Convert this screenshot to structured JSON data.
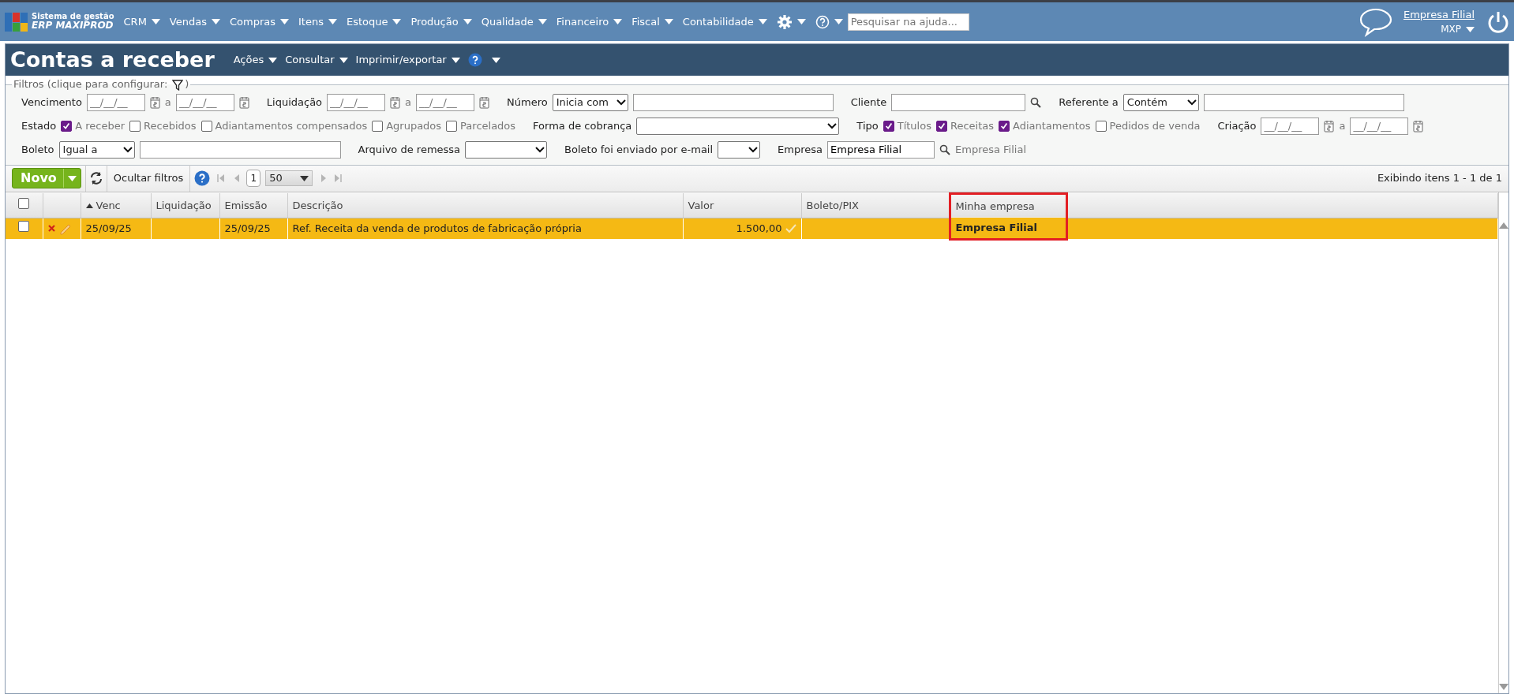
{
  "topbar": {
    "logo_line1": "Sistema de gestão",
    "logo_line2": "ERP MAXIPROD",
    "menu": [
      "CRM",
      "Vendas",
      "Compras",
      "Itens",
      "Estoque",
      "Produção",
      "Qualidade",
      "Financeiro",
      "Fiscal",
      "Contabilidade"
    ],
    "search": {
      "placeholder": "Pesquisar na ajuda..."
    },
    "company_link": "Empresa Filial",
    "user": "MXP"
  },
  "page": {
    "title": "Contas a receber",
    "menu": [
      "Ações",
      "Consultar",
      "Imprimir/exportar"
    ]
  },
  "filters": {
    "legend_start": "Filtros (clique para configurar:",
    "legend_end": ")",
    "rows": [
      {
        "items": [
          {
            "kind": "label",
            "text": "Vencimento"
          },
          {
            "kind": "date",
            "placeholder": "__/__/__"
          },
          {
            "kind": "sep",
            "text": "a"
          },
          {
            "kind": "date",
            "placeholder": "__/__/__"
          },
          {
            "kind": "label",
            "text": "Liquidação"
          },
          {
            "kind": "date",
            "placeholder": "__/__/__"
          },
          {
            "kind": "sep",
            "text": "a"
          },
          {
            "kind": "date",
            "placeholder": "__/__/__"
          },
          {
            "kind": "label",
            "text": "Número"
          },
          {
            "kind": "select",
            "value": "Inicia com"
          },
          {
            "kind": "input"
          },
          {
            "kind": "label",
            "text": "Cliente"
          },
          {
            "kind": "input"
          },
          {
            "kind": "search"
          },
          {
            "kind": "label",
            "text": "Referente a"
          },
          {
            "kind": "select",
            "value": "Contém"
          },
          {
            "kind": "input"
          }
        ]
      },
      {
        "items": [
          {
            "kind": "label",
            "text": "Estado"
          },
          {
            "kind": "checkbox",
            "text": "A receber",
            "checked": true
          },
          {
            "kind": "checkbox",
            "text": "Recebidos",
            "checked": false
          },
          {
            "kind": "checkbox",
            "text": "Adiantamentos compensados",
            "checked": false
          },
          {
            "kind": "checkbox",
            "text": "Agrupados",
            "checked": false
          },
          {
            "kind": "checkbox",
            "text": "Parcelados",
            "checked": false
          },
          {
            "kind": "label",
            "text": "Forma de cobrança"
          },
          {
            "kind": "select"
          },
          {
            "kind": "label",
            "text": "Tipo"
          },
          {
            "kind": "checkbox",
            "text": "Títulos",
            "checked": true
          },
          {
            "kind": "checkbox",
            "text": "Receitas",
            "checked": true
          },
          {
            "kind": "checkbox",
            "text": "Adiantamentos",
            "checked": true
          },
          {
            "kind": "checkbox",
            "text": "Pedidos de venda",
            "checked": false
          },
          {
            "kind": "label",
            "text": "Criação"
          },
          {
            "kind": "date",
            "placeholder": "__/__/__"
          },
          {
            "kind": "sep",
            "text": "a"
          },
          {
            "kind": "date",
            "placeholder": "__/__/__"
          }
        ]
      },
      {
        "items": [
          {
            "kind": "label",
            "text": "Boleto"
          },
          {
            "kind": "select",
            "value": "Igual a"
          },
          {
            "kind": "input"
          },
          {
            "kind": "label",
            "text": "Arquivo de remessa"
          },
          {
            "kind": "select"
          },
          {
            "kind": "label",
            "text": "Boleto foi enviado por e-mail"
          },
          {
            "kind": "select"
          },
          {
            "kind": "label",
            "text": "Empresa"
          },
          {
            "kind": "input",
            "value": "Empresa Filial"
          },
          {
            "kind": "search"
          },
          {
            "kind": "hint",
            "text": "Empresa Filial"
          }
        ]
      }
    ]
  },
  "toolbar": {
    "new_button": "Novo",
    "toggle_filters": "Ocultar filtros",
    "page": "1",
    "page_size": "50",
    "summary": "Exibindo itens 1 - 1 de 1"
  },
  "table": {
    "columns": [
      {
        "kind": "checkbox",
        "checked": false
      },
      {
        "kind": "blank"
      },
      {
        "kind": "text",
        "label": "Venc",
        "sorted": true
      },
      {
        "kind": "text",
        "label": "Liquidação",
        "sorted": false
      },
      {
        "kind": "text",
        "label": "Emissão",
        "sorted": false
      },
      {
        "kind": "text",
        "label": "Descrição",
        "sorted": false
      },
      {
        "kind": "text",
        "label": "Valor",
        "sorted": false
      },
      {
        "kind": "text",
        "label": "Boleto/PIX",
        "sorted": false
      },
      {
        "kind": "text",
        "label": "Minha empresa",
        "sorted": false,
        "highlighted": true
      },
      {
        "kind": "blank"
      }
    ],
    "rows": [
      {
        "selected": true,
        "cells": [
          {
            "kind": "checkbox",
            "checked": false
          },
          {
            "kind": "actions"
          },
          {
            "kind": "text",
            "text": "25/09/25"
          },
          {
            "kind": "blank"
          },
          {
            "kind": "text",
            "text": "25/09/25"
          },
          {
            "kind": "text",
            "text": "Ref. Receita da venda de produtos de fabricação própria"
          },
          {
            "kind": "amount",
            "text": "1.500,00"
          },
          {
            "kind": "blank"
          },
          {
            "kind": "text",
            "text": "Empresa Filial"
          },
          {
            "kind": "blank"
          }
        ]
      }
    ]
  }
}
